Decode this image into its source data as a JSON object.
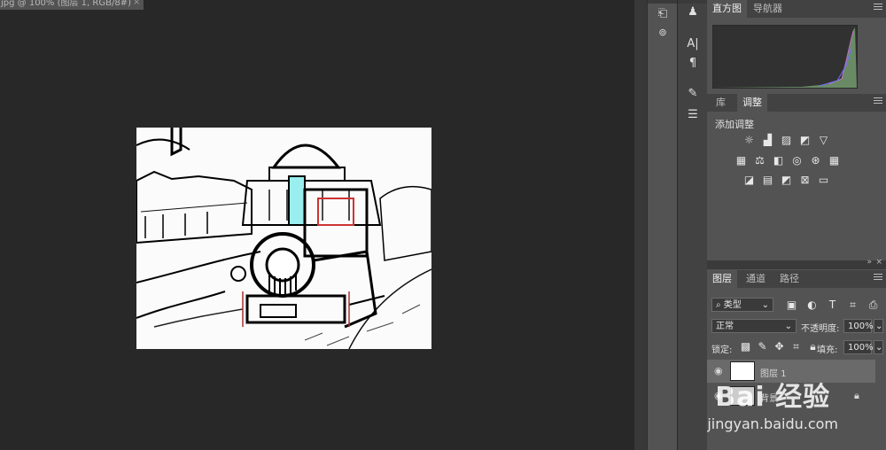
{
  "document": {
    "tab_title": "jpg @ 100% (图层 1, RGB/8#)",
    "close_glyph": "×"
  },
  "panels": {
    "histogram_tabs": [
      "直方图",
      "导航器"
    ],
    "adjust_tabs": [
      "库",
      "调整"
    ],
    "adjust_label": "添加调整",
    "adjust_icons_row1": [
      "brightness-icon",
      "levels-icon",
      "curves-icon",
      "exposure-icon",
      "gradient-triangle-icon"
    ],
    "adjust_icons_row2": [
      "vibrance-icon",
      "balance-icon",
      "bw-icon",
      "photo-filter-icon",
      "channel-mixer-icon",
      "color-lookup-icon"
    ],
    "adjust_icons_row3": [
      "invert-icon",
      "posterize-icon",
      "threshold-icon",
      "selective-color-icon",
      "gradient-map-icon"
    ],
    "layers_tabs": [
      "图层",
      "通道",
      "路径"
    ],
    "kind_filter": "类型",
    "blend_mode": "正常",
    "opacity_label": "不透明度:",
    "opacity_value": "100%",
    "lock_label": "锁定:",
    "fill_label": "填充:",
    "fill_value": "100%",
    "layers": [
      {
        "name": "图层 1"
      },
      {
        "name": "背景"
      }
    ]
  },
  "watermark": {
    "brand": "Bai  经验",
    "url": "jingyan.baidu.com"
  },
  "colors": {
    "panel": "#535353",
    "dark": "#282828",
    "tabbar": "#424242"
  }
}
